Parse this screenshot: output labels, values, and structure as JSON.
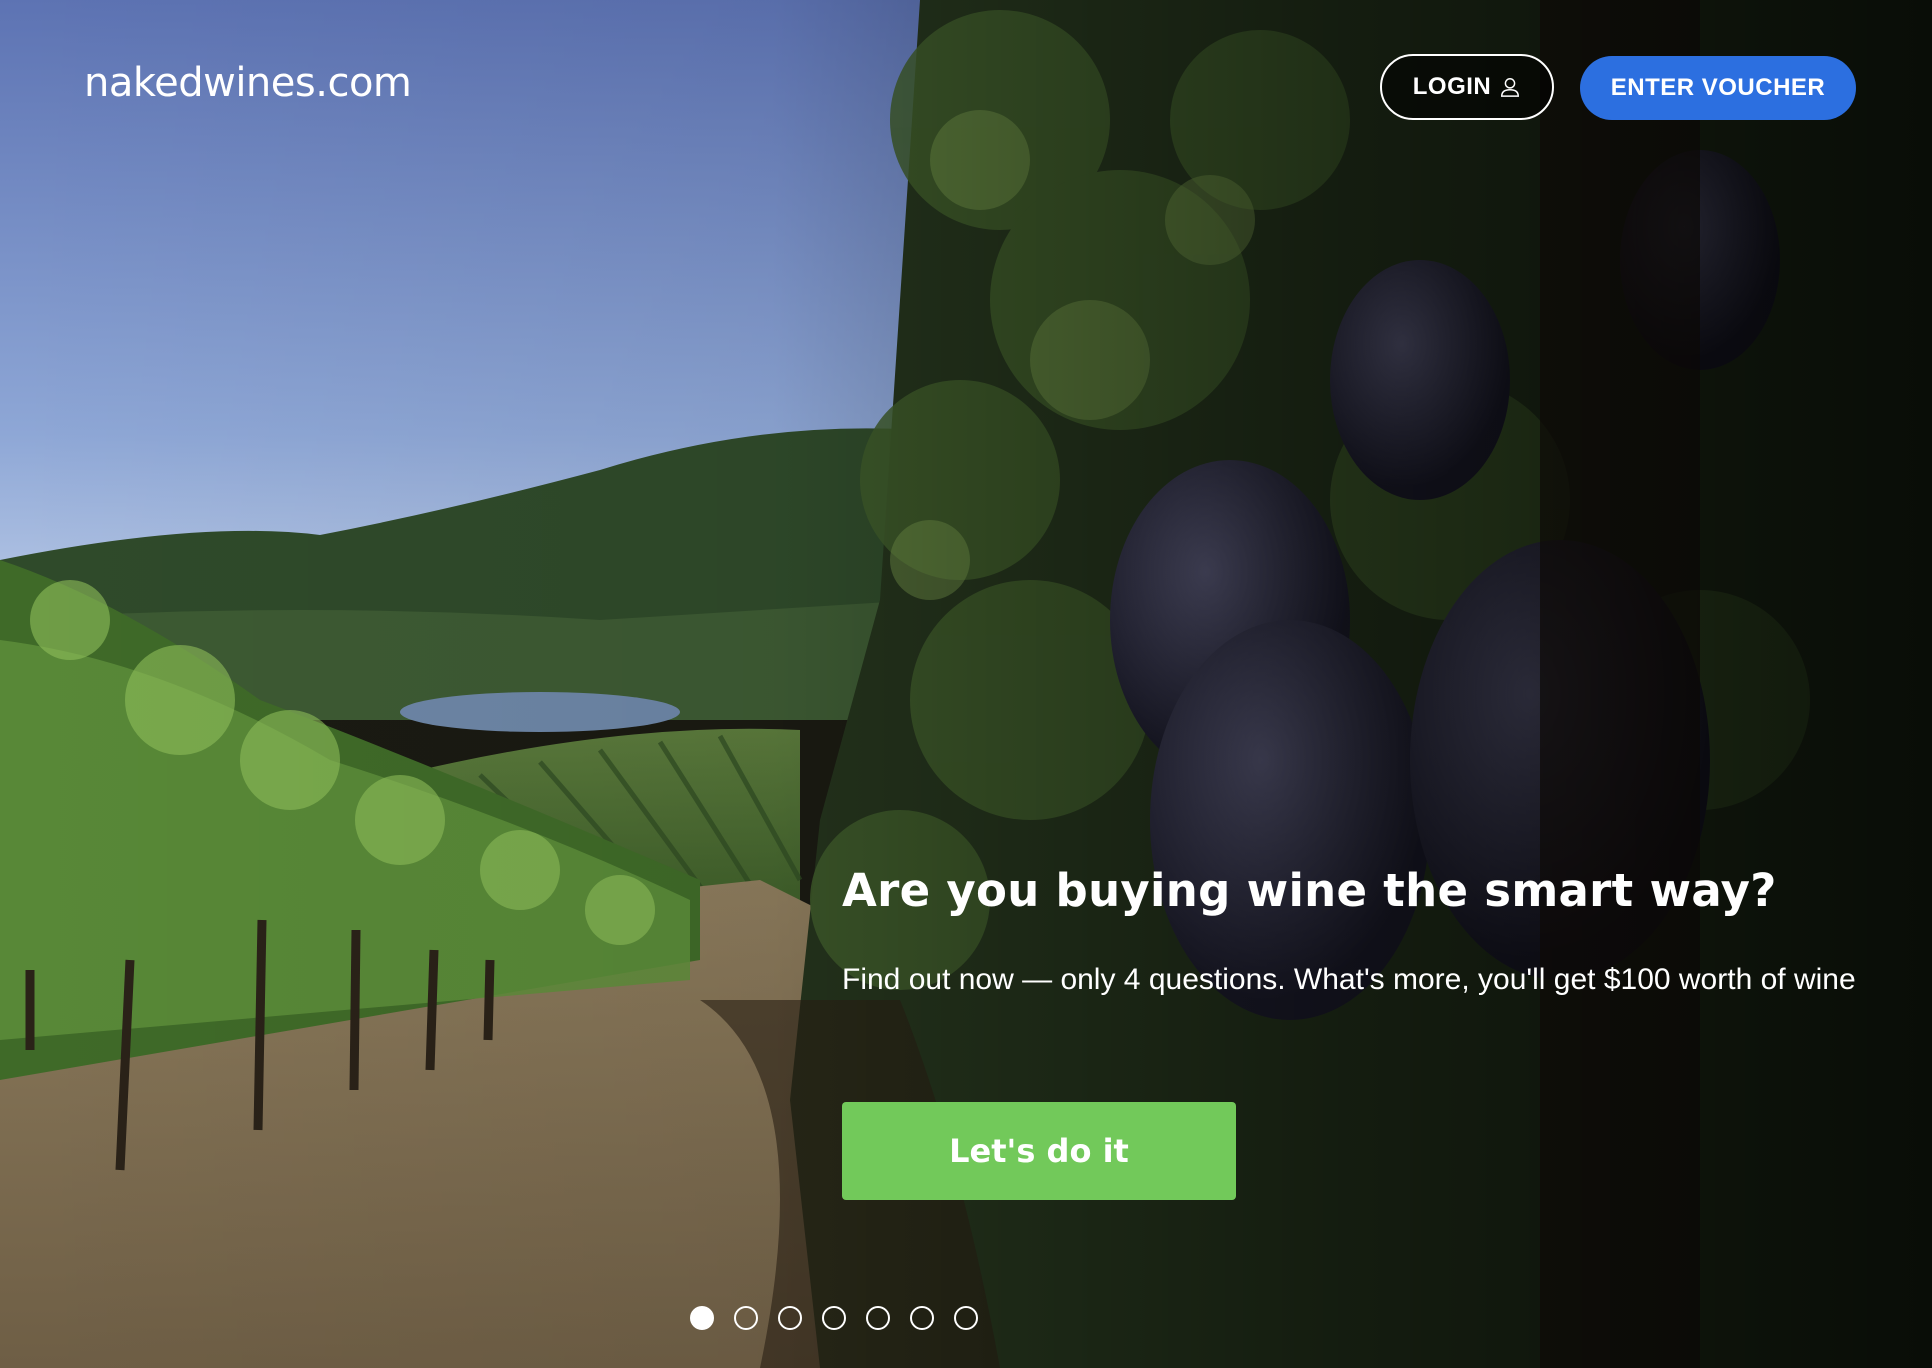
{
  "header": {
    "logo_text": "nakedwines.com",
    "login_label": "LOGIN",
    "voucher_label": "ENTER VOUCHER"
  },
  "promo": {
    "headline": "Are you buying wine the smart way?",
    "subtext": "Find out now — only 4 questions. What's more, you'll get $100 worth of wine",
    "cta_label": "Let's do it"
  },
  "carousel": {
    "slide_count": 7,
    "active_slide": 1
  },
  "colors": {
    "voucher_button": "#2c6fe0",
    "cta_button": "#72c95a",
    "text": "#ffffff"
  },
  "icons": {
    "login": "user-icon"
  }
}
